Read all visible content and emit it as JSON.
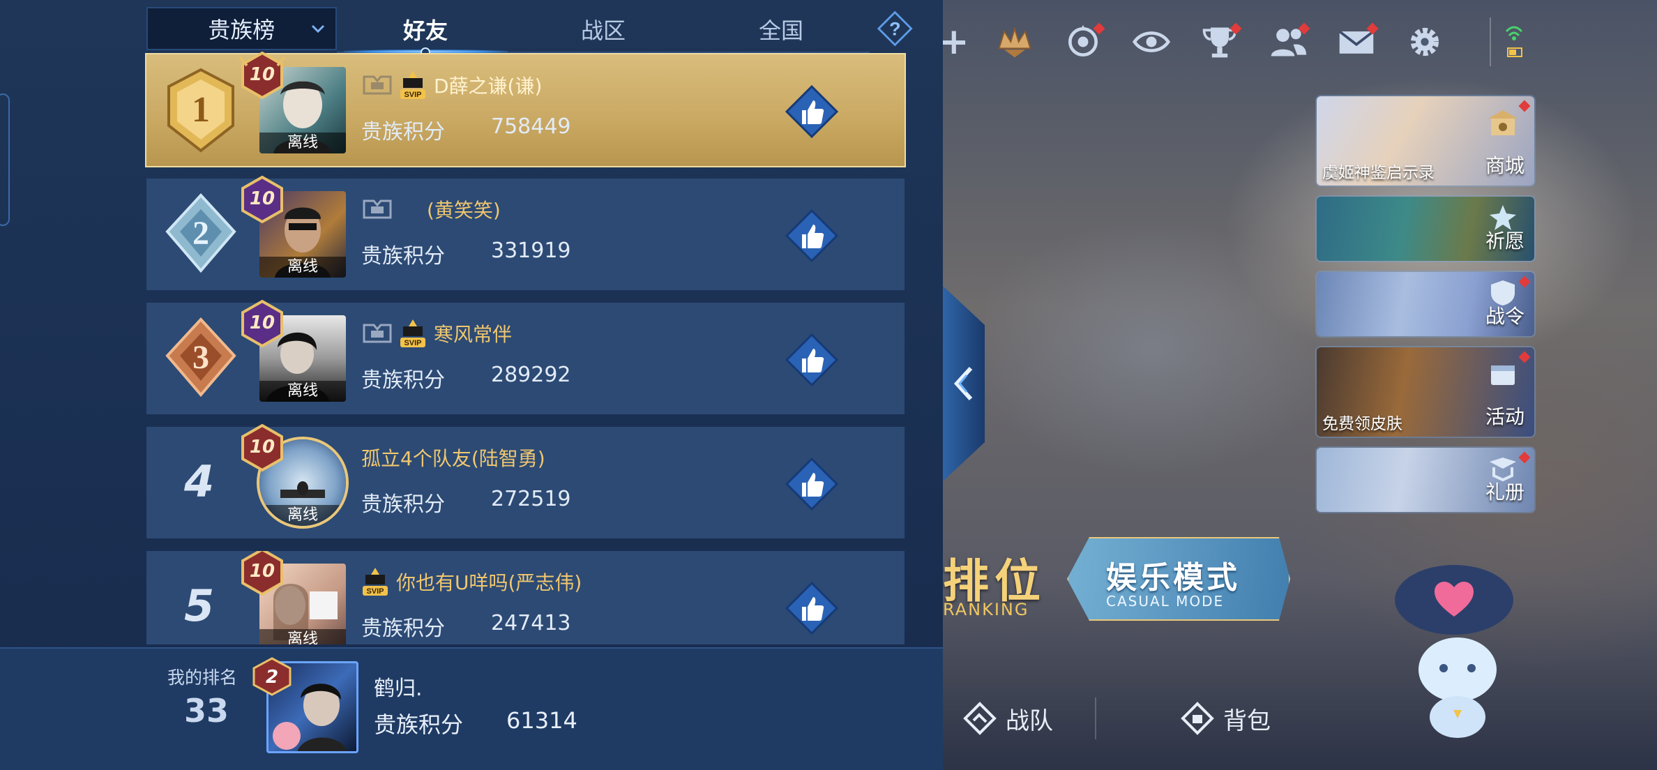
{
  "tabs": {
    "dropdown_label": "贵族榜",
    "items": [
      "好友",
      "战区",
      "全国"
    ],
    "active_index": 0
  },
  "rows": [
    {
      "rank": "1",
      "vip_level": "10",
      "status": "离线",
      "name": "D薛之谦(谦)",
      "score_label": "贵族积分",
      "score": "758449",
      "svip": true,
      "noble_icon": true
    },
    {
      "rank": "2",
      "vip_level": "10",
      "status": "离线",
      "name": "(黄笑笑)",
      "score_label": "贵族积分",
      "score": "331919",
      "svip": false,
      "noble_icon": true
    },
    {
      "rank": "3",
      "vip_level": "10",
      "status": "离线",
      "name": "寒风常伴",
      "score_label": "贵族积分",
      "score": "289292",
      "svip": true,
      "noble_icon": true
    },
    {
      "rank": "4",
      "vip_level": "10",
      "status": "离线",
      "name": "孤立4个队友(陆智勇)",
      "score_label": "贵族积分",
      "score": "272519",
      "svip": false,
      "noble_icon": false
    },
    {
      "rank": "5",
      "vip_level": "10",
      "status": "离线",
      "name": "你也有U咩吗(严志伟)",
      "score_label": "贵族积分",
      "score": "247413",
      "svip": true,
      "noble_icon": false
    }
  ],
  "svip_text": "SVIP",
  "me": {
    "label": "我的排名",
    "rank": "33",
    "vip_level": "2",
    "name": "鹤归.",
    "score_label": "贵族积分",
    "score": "61314"
  },
  "side_tiles": [
    {
      "label": "商城",
      "sub": "虞姬神鉴启示录"
    },
    {
      "label": "祈愿",
      "sub": ""
    },
    {
      "label": "战令",
      "sub": ""
    },
    {
      "label": "活动",
      "sub": "免费领皮肤"
    },
    {
      "label": "礼册",
      "sub": ""
    }
  ],
  "modes": {
    "rank_big": "排位",
    "rank_small": "RANKING",
    "casual_big": "娱乐模式",
    "casual_small": "CASUAL MODE"
  },
  "bottom_nav": [
    "战队",
    "背包"
  ],
  "top_icons": [
    "plus-icon",
    "crown-icon",
    "target-icon",
    "eye-icon",
    "trophy-icon",
    "friends-icon",
    "mail-icon",
    "gear-icon",
    "wifi-icon"
  ],
  "colors": {
    "gold": "#f2c76a",
    "panel": "#1f3658",
    "row": "#2c4a74",
    "accent_blue": "#3a8ee6",
    "red_dot": "#e23b3b"
  }
}
